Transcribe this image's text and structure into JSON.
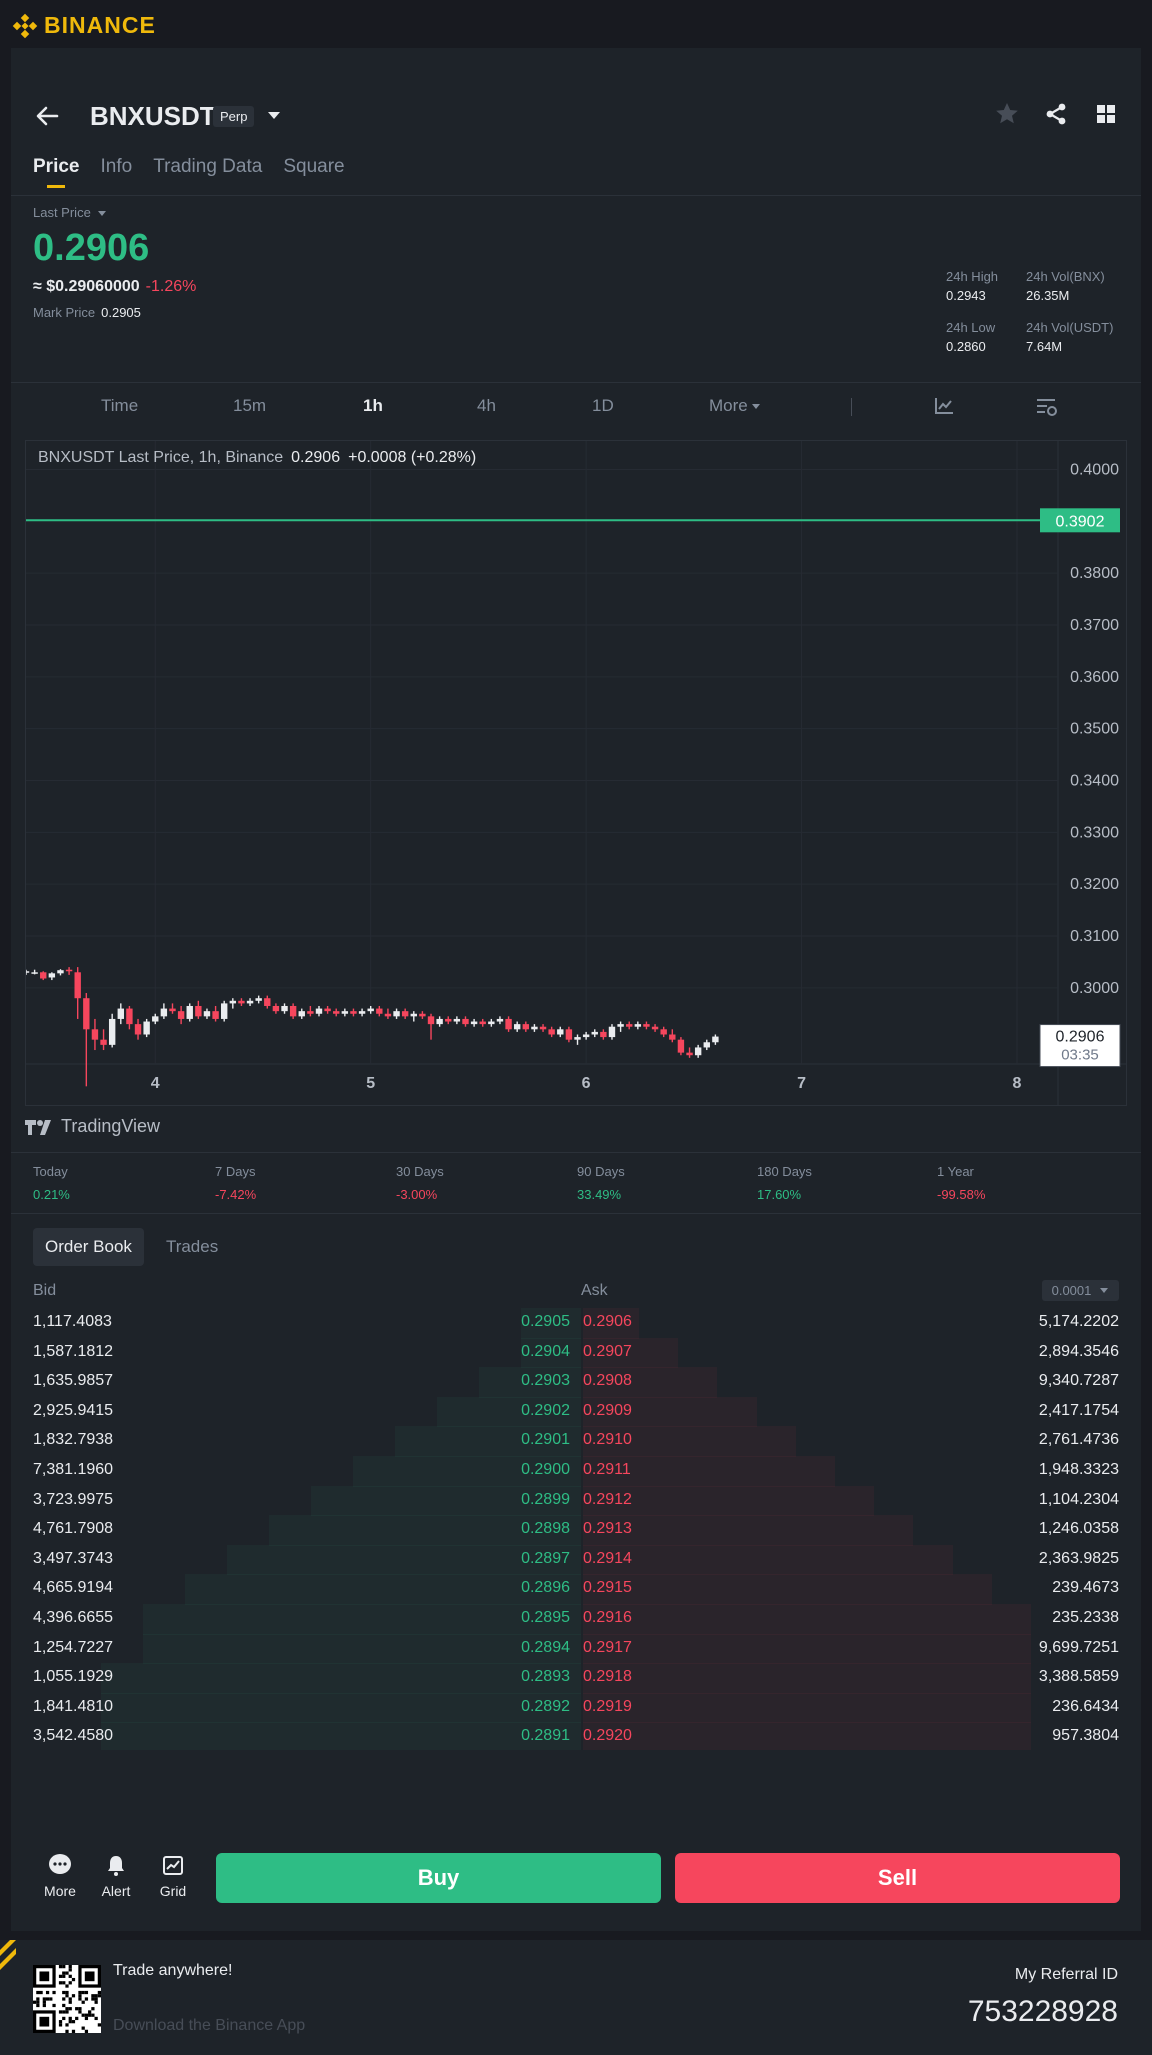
{
  "brand": {
    "name": "BINANCE",
    "color": "#f0b90b"
  },
  "header": {
    "symbol": "BNXUSDT",
    "badge": "Perp",
    "tabs": [
      {
        "label": "Price",
        "active": true
      },
      {
        "label": "Info",
        "active": false
      },
      {
        "label": "Trading Data",
        "active": false
      },
      {
        "label": "Square",
        "active": false
      }
    ],
    "icons": [
      "star-icon",
      "share-icon",
      "grid-icon"
    ]
  },
  "ticker": {
    "last_label": "Last Price",
    "last_price": "0.2906",
    "usd_value": "≈ $0.29060000",
    "change": "-1.26%",
    "mark_label": "Mark Price",
    "mark_price": "0.2905",
    "high_label": "24h High",
    "high": "0.2943",
    "low_label": "24h Low",
    "low": "0.2860",
    "vol_base_label": "24h Vol(BNX)",
    "vol_base": "26.35M",
    "vol_quote_label": "24h Vol(USDT)",
    "vol_quote": "7.64M"
  },
  "intervals": [
    {
      "label": "Time",
      "active": false
    },
    {
      "label": "15m",
      "active": false
    },
    {
      "label": "1h",
      "active": true
    },
    {
      "label": "4h",
      "active": false
    },
    {
      "label": "1D",
      "active": false
    },
    {
      "label": "More",
      "active": false
    }
  ],
  "chart_legend": {
    "text": "BNXUSDT Last Price, 1h, Binance",
    "price": "0.2906",
    "change": "+0.0008 (+0.28%)"
  },
  "chart_data": {
    "type": "candlestick",
    "x_ticks": [
      "4",
      "5",
      "6",
      "7",
      "8"
    ],
    "y_ticks": [
      "0.4000",
      "0.3800",
      "0.3700",
      "0.3600",
      "0.3500",
      "0.3400",
      "0.3300",
      "0.3200",
      "0.3100",
      "0.3000"
    ],
    "ylim": [
      0.2855,
      0.4055
    ],
    "xlim": [
      3.4,
      8.0
    ],
    "price_line": {
      "value": 0.3902,
      "label": "0.3902",
      "color": "#2ebd85"
    },
    "current_price": {
      "label": "0.2906",
      "countdown": "03:35"
    },
    "up_color": "#eaecef",
    "down_color": "#f6465d",
    "candles": [
      [
        3.4,
        0.303,
        0.3035,
        0.3025,
        0.3032
      ],
      [
        3.44,
        0.303,
        0.3035,
        0.3026,
        0.303
      ],
      [
        3.48,
        0.303,
        0.3032,
        0.3015,
        0.3018
      ],
      [
        3.52,
        0.302,
        0.303,
        0.3015,
        0.3028
      ],
      [
        3.56,
        0.3028,
        0.3036,
        0.3024,
        0.3034
      ],
      [
        3.6,
        0.3035,
        0.304,
        0.3025,
        0.3032
      ],
      [
        3.64,
        0.303,
        0.304,
        0.294,
        0.298
      ],
      [
        3.68,
        0.298,
        0.299,
        0.281,
        0.292
      ],
      [
        3.72,
        0.292,
        0.294,
        0.288,
        0.29
      ],
      [
        3.76,
        0.29,
        0.292,
        0.288,
        0.289
      ],
      [
        3.8,
        0.289,
        0.295,
        0.2885,
        0.294
      ],
      [
        3.84,
        0.294,
        0.297,
        0.293,
        0.296
      ],
      [
        3.88,
        0.296,
        0.2965,
        0.292,
        0.293
      ],
      [
        3.92,
        0.293,
        0.294,
        0.29,
        0.291
      ],
      [
        3.96,
        0.291,
        0.294,
        0.2905,
        0.2935
      ],
      [
        4.0,
        0.2935,
        0.295,
        0.293,
        0.2945
      ],
      [
        4.04,
        0.2945,
        0.297,
        0.294,
        0.296
      ],
      [
        4.08,
        0.296,
        0.297,
        0.295,
        0.2955
      ],
      [
        4.12,
        0.2955,
        0.2965,
        0.293,
        0.294
      ],
      [
        4.16,
        0.294,
        0.297,
        0.2935,
        0.2965
      ],
      [
        4.2,
        0.2965,
        0.2975,
        0.294,
        0.2945
      ],
      [
        4.24,
        0.2945,
        0.296,
        0.294,
        0.2955
      ],
      [
        4.28,
        0.2955,
        0.2965,
        0.2935,
        0.294
      ],
      [
        4.32,
        0.294,
        0.2975,
        0.2935,
        0.297
      ],
      [
        4.36,
        0.297,
        0.298,
        0.296,
        0.2975
      ],
      [
        4.4,
        0.2975,
        0.298,
        0.2965,
        0.297
      ],
      [
        4.44,
        0.297,
        0.298,
        0.2965,
        0.2975
      ],
      [
        4.48,
        0.2975,
        0.2985,
        0.297,
        0.298
      ],
      [
        4.52,
        0.298,
        0.2985,
        0.296,
        0.2965
      ],
      [
        4.56,
        0.2965,
        0.297,
        0.295,
        0.2955
      ],
      [
        4.6,
        0.2955,
        0.297,
        0.295,
        0.2965
      ],
      [
        4.64,
        0.2965,
        0.297,
        0.294,
        0.2945
      ],
      [
        4.68,
        0.2945,
        0.296,
        0.294,
        0.2955
      ],
      [
        4.72,
        0.2955,
        0.2965,
        0.2945,
        0.295
      ],
      [
        4.76,
        0.295,
        0.2965,
        0.2945,
        0.296
      ],
      [
        4.8,
        0.296,
        0.2965,
        0.295,
        0.2955
      ],
      [
        4.84,
        0.2955,
        0.296,
        0.2945,
        0.295
      ],
      [
        4.88,
        0.295,
        0.296,
        0.2945,
        0.2955
      ],
      [
        4.92,
        0.2955,
        0.296,
        0.2945,
        0.295
      ],
      [
        4.96,
        0.295,
        0.296,
        0.2945,
        0.2955
      ],
      [
        5.0,
        0.2955,
        0.2965,
        0.295,
        0.296
      ],
      [
        5.04,
        0.296,
        0.2965,
        0.2945,
        0.295
      ],
      [
        5.08,
        0.295,
        0.296,
        0.294,
        0.2945
      ],
      [
        5.12,
        0.2945,
        0.296,
        0.294,
        0.2955
      ],
      [
        5.16,
        0.2955,
        0.296,
        0.294,
        0.2945
      ],
      [
        5.2,
        0.2945,
        0.2955,
        0.2935,
        0.295
      ],
      [
        5.24,
        0.295,
        0.2955,
        0.294,
        0.2945
      ],
      [
        5.28,
        0.2945,
        0.295,
        0.29,
        0.293
      ],
      [
        5.32,
        0.293,
        0.2945,
        0.2925,
        0.294
      ],
      [
        5.36,
        0.294,
        0.2945,
        0.293,
        0.2935
      ],
      [
        5.4,
        0.2935,
        0.2945,
        0.293,
        0.294
      ],
      [
        5.44,
        0.294,
        0.2945,
        0.2925,
        0.293
      ],
      [
        5.48,
        0.293,
        0.294,
        0.2925,
        0.2935
      ],
      [
        5.52,
        0.2935,
        0.294,
        0.2925,
        0.293
      ],
      [
        5.56,
        0.293,
        0.294,
        0.2925,
        0.2935
      ],
      [
        5.6,
        0.2935,
        0.2945,
        0.293,
        0.294
      ],
      [
        5.64,
        0.294,
        0.2945,
        0.2915,
        0.292
      ],
      [
        5.68,
        0.292,
        0.2935,
        0.2915,
        0.293
      ],
      [
        5.72,
        0.293,
        0.2935,
        0.2915,
        0.292
      ],
      [
        5.76,
        0.292,
        0.293,
        0.2915,
        0.2925
      ],
      [
        5.8,
        0.2925,
        0.293,
        0.2915,
        0.292
      ],
      [
        5.84,
        0.292,
        0.2925,
        0.2905,
        0.291
      ],
      [
        5.88,
        0.291,
        0.2925,
        0.2905,
        0.292
      ],
      [
        5.92,
        0.292,
        0.2925,
        0.2895,
        0.29
      ],
      [
        5.96,
        0.29,
        0.291,
        0.289,
        0.2905
      ],
      [
        6.0,
        0.2905,
        0.2915,
        0.29,
        0.291
      ],
      [
        6.04,
        0.291,
        0.292,
        0.2905,
        0.2915
      ],
      [
        6.08,
        0.2915,
        0.292,
        0.29,
        0.2905
      ],
      [
        6.12,
        0.2905,
        0.293,
        0.29,
        0.2925
      ],
      [
        6.16,
        0.2925,
        0.2935,
        0.2915,
        0.293
      ],
      [
        6.2,
        0.293,
        0.2935,
        0.292,
        0.2925
      ],
      [
        6.24,
        0.2925,
        0.2935,
        0.292,
        0.293
      ],
      [
        6.28,
        0.293,
        0.2935,
        0.292,
        0.2925
      ],
      [
        6.32,
        0.2925,
        0.293,
        0.2915,
        0.292
      ],
      [
        6.36,
        0.292,
        0.2925,
        0.2905,
        0.291
      ],
      [
        6.4,
        0.291,
        0.292,
        0.2895,
        0.29
      ],
      [
        6.44,
        0.29,
        0.2905,
        0.287,
        0.2875
      ],
      [
        6.48,
        0.2875,
        0.2885,
        0.2865,
        0.287
      ],
      [
        6.52,
        0.287,
        0.289,
        0.2865,
        0.2885
      ],
      [
        6.56,
        0.2885,
        0.29,
        0.288,
        0.2895
      ],
      [
        6.6,
        0.2895,
        0.291,
        0.289,
        0.2906
      ]
    ]
  },
  "tradingview_label": "TradingView",
  "performance": [
    {
      "label": "Today",
      "value": "0.21%",
      "dir": "up"
    },
    {
      "label": "7 Days",
      "value": "-7.42%",
      "dir": "down"
    },
    {
      "label": "30 Days",
      "value": "-3.00%",
      "dir": "down"
    },
    {
      "label": "90 Days",
      "value": "33.49%",
      "dir": "up"
    },
    {
      "label": "180 Days",
      "value": "17.60%",
      "dir": "up"
    },
    {
      "label": "1 Year",
      "value": "-99.58%",
      "dir": "down"
    }
  ],
  "orderbook": {
    "tabs": [
      {
        "label": "Order Book",
        "active": true
      },
      {
        "label": "Trades",
        "active": false
      }
    ],
    "bid_label": "Bid",
    "ask_label": "Ask",
    "precision": "0.0001",
    "rows": [
      {
        "bid_qty": "1,117.4083",
        "bid": "0.2905",
        "ask": "0.2906",
        "ask_qty": "5,174.2202"
      },
      {
        "bid_qty": "1,587.1812",
        "bid": "0.2904",
        "ask": "0.2907",
        "ask_qty": "2,894.3546"
      },
      {
        "bid_qty": "1,635.9857",
        "bid": "0.2903",
        "ask": "0.2908",
        "ask_qty": "9,340.7287"
      },
      {
        "bid_qty": "2,925.9415",
        "bid": "0.2902",
        "ask": "0.2909",
        "ask_qty": "2,417.1754"
      },
      {
        "bid_qty": "1,832.7938",
        "bid": "0.2901",
        "ask": "0.2910",
        "ask_qty": "2,761.4736"
      },
      {
        "bid_qty": "7,381.1960",
        "bid": "0.2900",
        "ask": "0.2911",
        "ask_qty": "1,948.3323"
      },
      {
        "bid_qty": "3,723.9975",
        "bid": "0.2899",
        "ask": "0.2912",
        "ask_qty": "1,104.2304"
      },
      {
        "bid_qty": "4,761.7908",
        "bid": "0.2898",
        "ask": "0.2913",
        "ask_qty": "1,246.0358"
      },
      {
        "bid_qty": "3,497.3743",
        "bid": "0.2897",
        "ask": "0.2914",
        "ask_qty": "2,363.9825"
      },
      {
        "bid_qty": "4,665.9194",
        "bid": "0.2896",
        "ask": "0.2915",
        "ask_qty": "239.4673"
      },
      {
        "bid_qty": "4,396.6655",
        "bid": "0.2895",
        "ask": "0.2916",
        "ask_qty": "235.2338"
      },
      {
        "bid_qty": "1,254.7227",
        "bid": "0.2894",
        "ask": "0.2917",
        "ask_qty": "9,699.7251"
      },
      {
        "bid_qty": "1,055.1929",
        "bid": "0.2893",
        "ask": "0.2918",
        "ask_qty": "3,388.5859"
      },
      {
        "bid_qty": "1,841.4810",
        "bid": "0.2892",
        "ask": "0.2919",
        "ask_qty": "236.6434"
      },
      {
        "bid_qty": "3,542.4580",
        "bid": "0.2891",
        "ask": "0.2920",
        "ask_qty": "957.3804"
      }
    ]
  },
  "bottom_bar": {
    "more": "More",
    "alert": "Alert",
    "grid": "Grid",
    "buy": "Buy",
    "sell": "Sell"
  },
  "footer": {
    "trade_anywhere": "Trade anywhere!",
    "download": "Download the Binance App",
    "referral_label": "My Referral ID",
    "referral_id": "753228928"
  }
}
